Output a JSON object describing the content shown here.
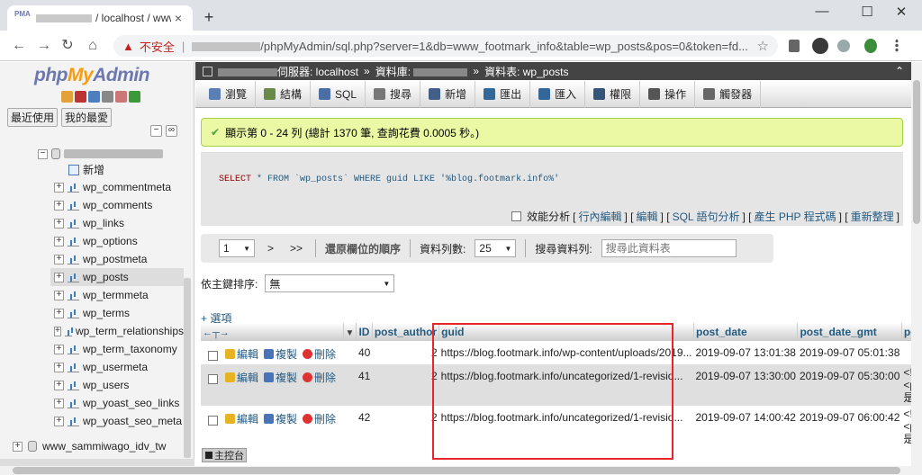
{
  "browser": {
    "tab_title": "/ localhost / www",
    "tab_close": "×",
    "new_tab": "+",
    "minimize": "—",
    "maximize": "☐",
    "close": "✕",
    "back": "←",
    "forward": "→",
    "reload": "↻",
    "home": "⌂",
    "insecure_label": "不安全",
    "url": "/phpMyAdmin/sql.php?server=1&db=www_footmark_info&table=wp_posts&pos=0&token=fd...",
    "bookmark_icon": "☆"
  },
  "nav": {
    "logo_php": "php",
    "logo_my": "My",
    "logo_admin": "Admin",
    "tab_recent": "最近使用",
    "tab_favorites": "我的最愛",
    "new_label": "新增",
    "tables": [
      "wp_commentmeta",
      "wp_comments",
      "wp_links",
      "wp_options",
      "wp_postmeta",
      "wp_posts",
      "wp_termmeta",
      "wp_terms",
      "wp_term_relationships",
      "wp_term_taxonomy",
      "wp_usermeta",
      "wp_users",
      "wp_yoast_seo_links",
      "wp_yoast_seo_meta"
    ],
    "selected_table": "wp_posts",
    "other_db": "www_sammiwago_idv_tw"
  },
  "breadcrumb": {
    "server_label": "伺服器: localhost",
    "db_label": "資料庫:",
    "table_label": "資料表: wp_posts"
  },
  "menu": {
    "items": [
      "瀏覽",
      "結構",
      "SQL",
      "搜尋",
      "新增",
      "匯出",
      "匯入",
      "權限",
      "操作",
      "觸發器"
    ]
  },
  "result": {
    "message": "顯示第 0 - 24 列 (總計 1370 筆, 查詢花費 0.0005 秒。)",
    "query_select": "SELECT",
    "query_rest": " * FROM `wp_posts` WHERE guid LIKE '%blog.footmark.info%'",
    "profiling": "效能分析",
    "links": [
      "行內編輯",
      "編輯",
      "SQL 語句分析",
      "產生 PHP 程式碼",
      "重新整理"
    ]
  },
  "pager": {
    "page_value": "1",
    "next": ">",
    "last": ">>",
    "restore_label": "還原欄位的順序",
    "rows_label": "資料列數:",
    "rows_value": "25",
    "filter_label": "搜尋資料列:",
    "filter_placeholder": "搜尋此資料表"
  },
  "sort": {
    "label": "依主鍵排序:",
    "value": "無"
  },
  "table": {
    "options_link": "+ 選項",
    "columns": [
      "ID",
      "post_author",
      "guid",
      "post_date",
      "post_date_gmt",
      "post_c"
    ],
    "action_edit": "編輯",
    "action_copy": "複製",
    "action_delete": "刪除",
    "rows": [
      {
        "id": "40",
        "author": "2",
        "guid": "https://blog.footmark.info/wp-content/uploads/2019...",
        "post_date": "2019-09-07 13:01:38",
        "post_date_gmt": "2019-09-07 05:01:38",
        "content_1": "",
        "content_2": "",
        "content_3": ""
      },
      {
        "id": "41",
        "author": "2",
        "guid": "https://blog.footmark.info/uncategorized/1-revisio...",
        "post_date": "2019-09-07 13:30:00",
        "post_date_gmt": "2019-09-07 05:30:00",
        "content_1": "<!-- wp",
        "content_2": "<p>歡迎",
        "content_3": "是這個"
      },
      {
        "id": "42",
        "author": "2",
        "guid": "https://blog.footmark.info/uncategorized/1-revisio...",
        "post_date": "2019-09-07 14:00:42",
        "post_date_gmt": "2019-09-07 06:00:42",
        "content_1": "<!-- wp",
        "content_2": "<p>歡迎",
        "content_3": "是這個"
      }
    ]
  },
  "console": {
    "label": "主控台"
  },
  "colors": {
    "highlight": "#e8262a",
    "success_bg": "#ebf8a4",
    "link": "#235a81"
  }
}
